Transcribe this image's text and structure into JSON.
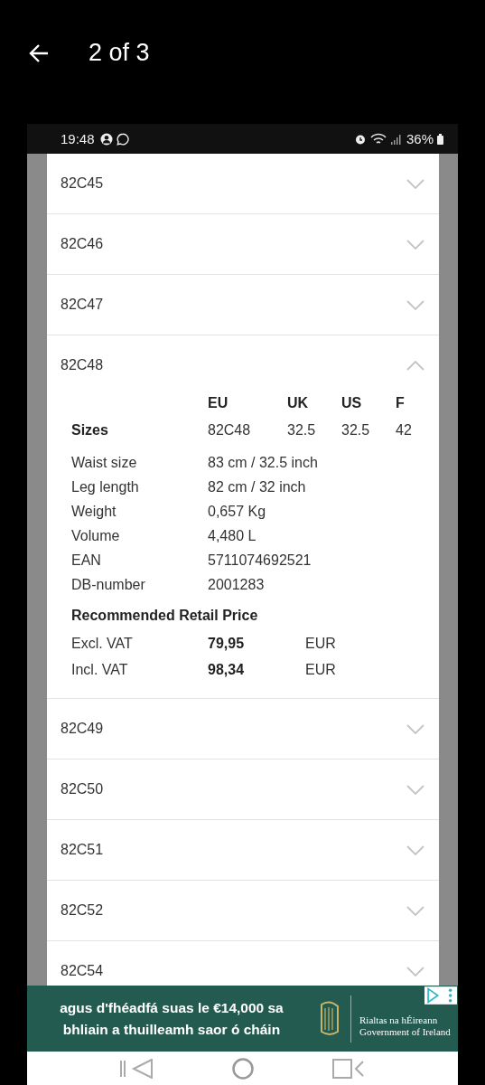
{
  "header": {
    "title": "2 of 3"
  },
  "status_bar": {
    "time": "19:48",
    "battery": "36%"
  },
  "sizes": [
    {
      "code": "82C45",
      "expanded": false
    },
    {
      "code": "82C46",
      "expanded": false
    },
    {
      "code": "82C47",
      "expanded": false
    },
    {
      "code": "82C48",
      "expanded": true,
      "details": {
        "size_columns": [
          "EU",
          "UK",
          "US",
          "F"
        ],
        "size_row": {
          "label": "Sizes",
          "values": [
            "82C48",
            "32.5",
            "32.5",
            "42"
          ]
        },
        "specs": [
          {
            "label": "Waist size",
            "value": "83 cm / 32.5 inch"
          },
          {
            "label": "Leg length",
            "value": "82 cm / 32 inch"
          },
          {
            "label": "Weight",
            "value": "0,657 Kg"
          },
          {
            "label": "Volume",
            "value": "4,480 L"
          },
          {
            "label": "EAN",
            "value": "5711074692521"
          },
          {
            "label": "DB-number",
            "value": "2001283"
          }
        ],
        "price_title": "Recommended Retail Price",
        "prices": [
          {
            "label": "Excl. VAT",
            "amount": "79,95",
            "currency": "EUR"
          },
          {
            "label": "Incl. VAT",
            "amount": "98,34",
            "currency": "EUR"
          }
        ]
      }
    },
    {
      "code": "82C49",
      "expanded": false
    },
    {
      "code": "82C50",
      "expanded": false
    },
    {
      "code": "82C51",
      "expanded": false
    },
    {
      "code": "82C52",
      "expanded": false
    },
    {
      "code": "82C54",
      "expanded": false
    }
  ],
  "ad": {
    "text": "agus d'fhéadfá suas le €14,000 sa bhliain a thuilleamh saor ó cháin",
    "brand_lines": [
      "Rialtas na hÉireann",
      "Government of Ireland"
    ]
  }
}
